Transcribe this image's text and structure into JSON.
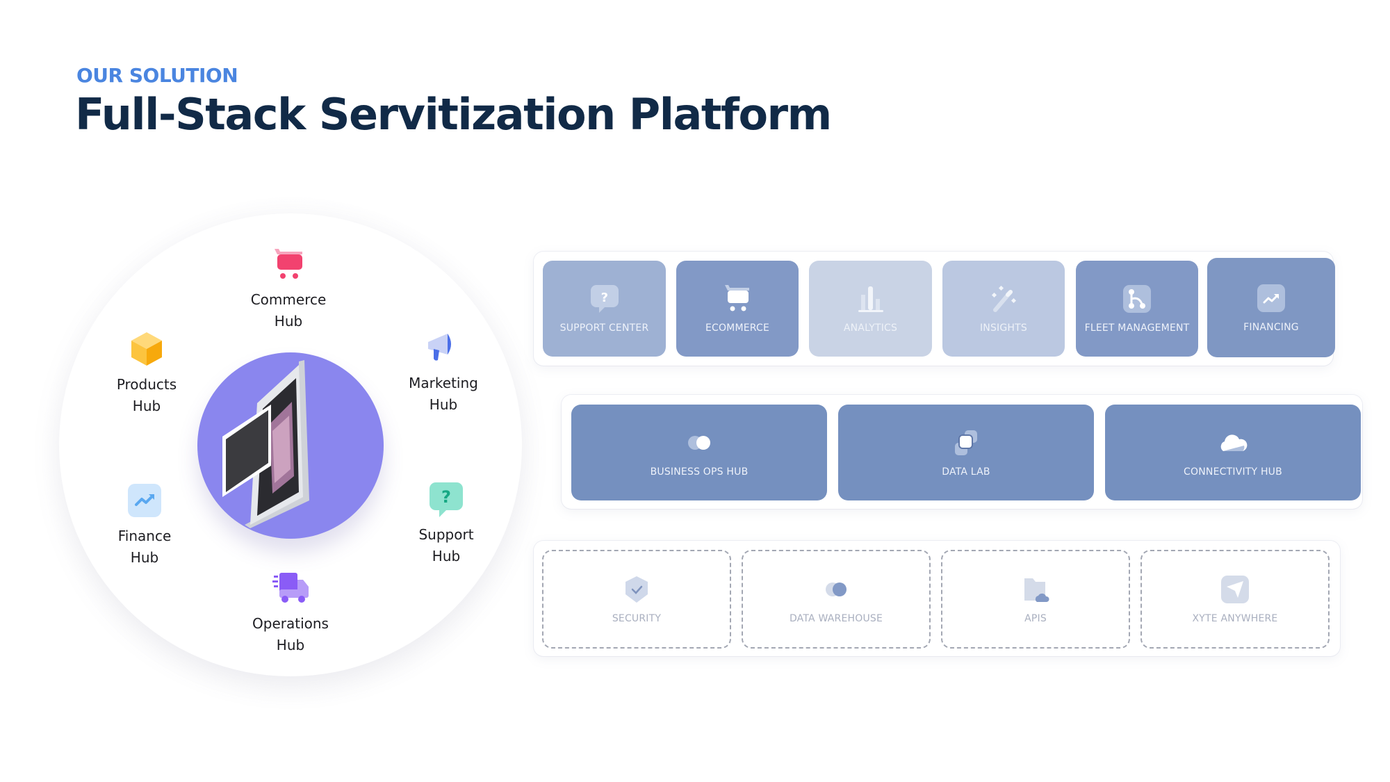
{
  "header": {
    "eyebrow": "OUR SOLUTION",
    "title": "Full-Stack Servitization Platform"
  },
  "wheel": {
    "center_image": "processor-chip-illustration",
    "hubs": [
      {
        "icon": "shopping-cart-icon",
        "line1": "Commerce",
        "line2": "Hub",
        "color": "#f2426f"
      },
      {
        "icon": "megaphone-icon",
        "line1": "Marketing",
        "line2": "Hub",
        "color": "#4b6fe8"
      },
      {
        "icon": "question-chat-icon",
        "line1": "Support",
        "line2": "Hub",
        "color": "#2fd1ad"
      },
      {
        "icon": "delivery-truck-icon",
        "line1": "Operations",
        "line2": "Hub",
        "color": "#8a5cf6"
      },
      {
        "icon": "trend-chart-icon",
        "line1": "Finance",
        "line2": "Hub",
        "color": "#5aa8f0"
      },
      {
        "icon": "cube-box-icon",
        "line1": "Products",
        "line2": "Hub",
        "color": "#fbb317"
      }
    ]
  },
  "platform": {
    "apps": [
      {
        "label": "SUPPORT CENTER",
        "icon": "question-chat-icon"
      },
      {
        "label": "ECOMMERCE",
        "icon": "shopping-cart-icon"
      },
      {
        "label": "ANALYTICS",
        "icon": "bar-chart-icon"
      },
      {
        "label": "INSIGHTS",
        "icon": "magic-wand-icon"
      },
      {
        "label": "FLEET MANAGEMENT",
        "icon": "route-icon"
      },
      {
        "label": "FINANCING",
        "icon": "trend-chart-icon"
      }
    ],
    "hubs": [
      {
        "label": "BUSINESS OPS HUB",
        "icon": "overlapping-circles-icon"
      },
      {
        "label": "DATA LAB",
        "icon": "stacked-squares-icon"
      },
      {
        "label": "CONNECTIVITY HUB",
        "icon": "cloud-icon"
      }
    ],
    "foundation": [
      {
        "label": "SECURITY",
        "icon": "shield-check-icon"
      },
      {
        "label": "DATA WAREHOUSE",
        "icon": "overlapping-circles-icon"
      },
      {
        "label": "APIs",
        "icon": "folder-cloud-icon"
      },
      {
        "label": "XYTE ANYWHERE",
        "icon": "send-arrow-icon"
      }
    ]
  },
  "colors": {
    "eyebrow": "#4a85e0",
    "title": "#112a47",
    "core_circle": "#8a86ee",
    "hub_card": "#7590bf"
  }
}
